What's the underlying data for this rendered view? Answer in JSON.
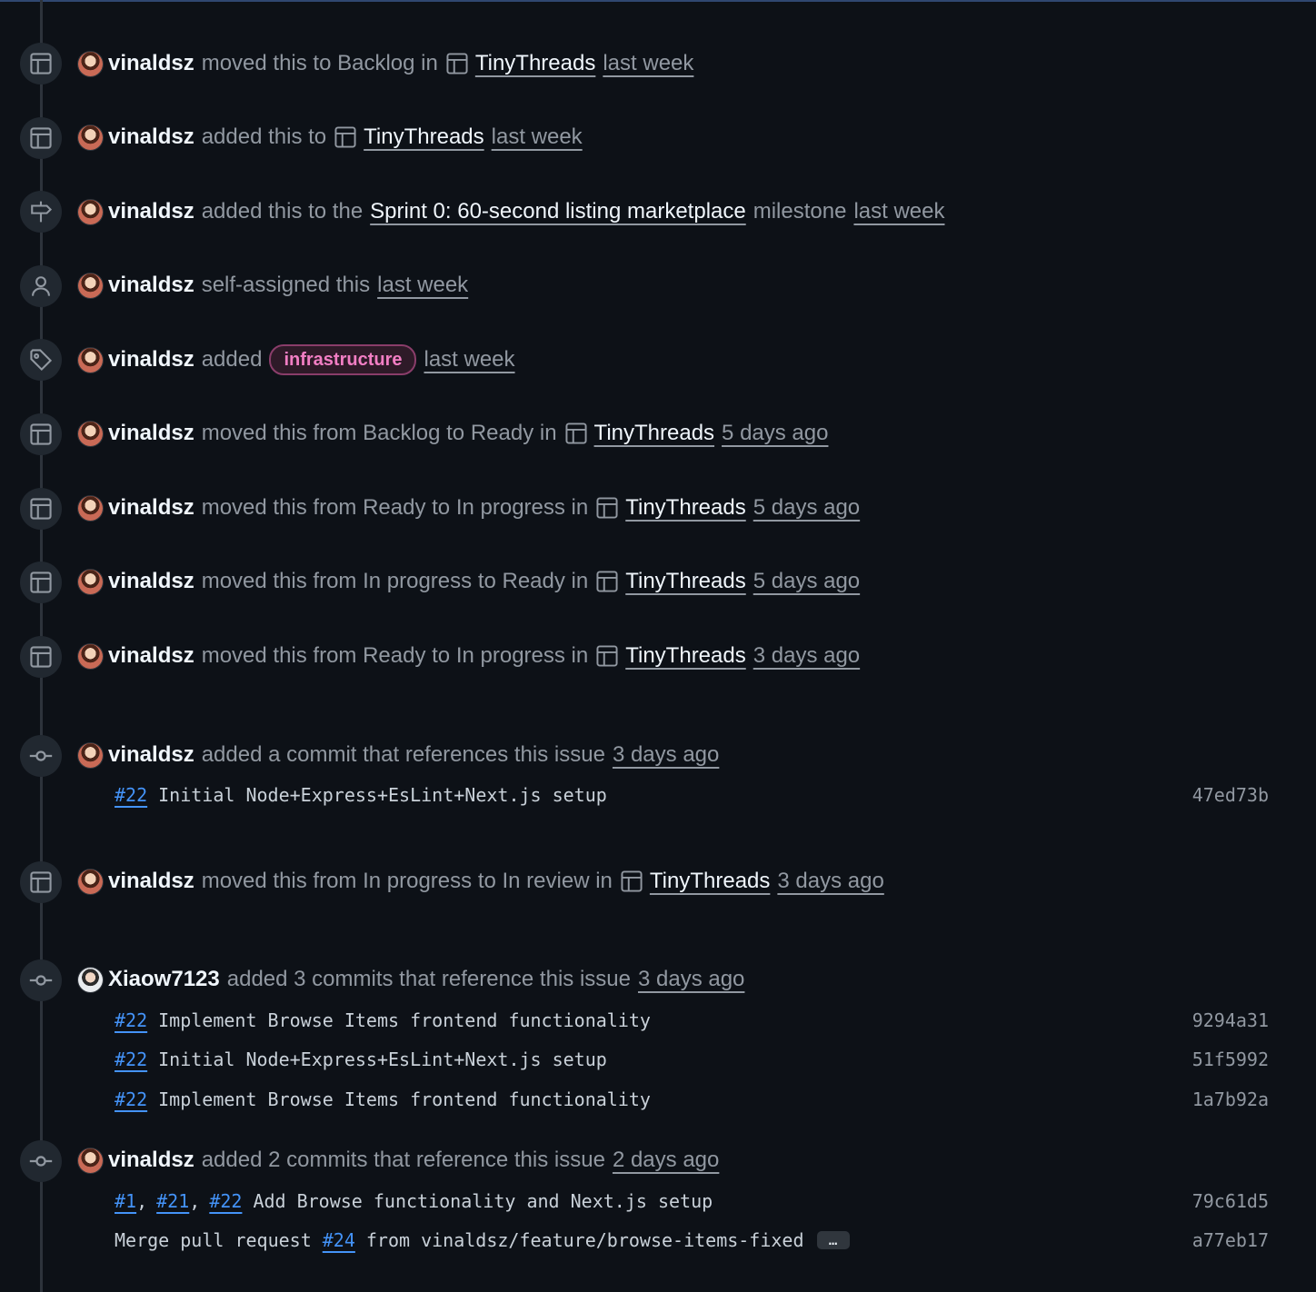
{
  "events": [
    {
      "icon": "project-icon",
      "user": "vinaldsz",
      "text": "moved this to Backlog in",
      "project": "TinyThreads",
      "time": "last week"
    },
    {
      "icon": "project-icon",
      "user": "vinaldsz",
      "text": "added this to",
      "project": "TinyThreads",
      "time": "last week"
    },
    {
      "icon": "milestone-icon",
      "user": "vinaldsz",
      "text": "added this to the",
      "milestone": "Sprint 0: 60-second listing marketplace",
      "text_after": "milestone",
      "time": "last week"
    },
    {
      "icon": "person-icon",
      "user": "vinaldsz",
      "text": "self-assigned this",
      "time": "last week"
    },
    {
      "icon": "tag-icon",
      "user": "vinaldsz",
      "text": "added",
      "label": "infrastructure",
      "time": "last week"
    },
    {
      "icon": "project-icon",
      "user": "vinaldsz",
      "text": "moved this from Backlog to Ready in",
      "project": "TinyThreads",
      "time": "5 days ago"
    },
    {
      "icon": "project-icon",
      "user": "vinaldsz",
      "text": "moved this from Ready to In progress in",
      "project": "TinyThreads",
      "time": "5 days ago"
    },
    {
      "icon": "project-icon",
      "user": "vinaldsz",
      "text": "moved this from In progress to Ready in",
      "project": "TinyThreads",
      "time": "5 days ago"
    },
    {
      "icon": "project-icon",
      "user": "vinaldsz",
      "text": "moved this from Ready to In progress in",
      "project": "TinyThreads",
      "time": "3 days ago"
    },
    {
      "icon": "commit-icon",
      "user": "vinaldsz",
      "text": "added a commit that references this issue",
      "time": "3 days ago",
      "commits": [
        {
          "refs": [
            "#22"
          ],
          "message": "Initial Node+Express+EsLint+Next.js setup",
          "sha": "47ed73b"
        }
      ]
    },
    {
      "icon": "project-icon",
      "user": "vinaldsz",
      "text": "moved this from In progress to In review in",
      "project": "TinyThreads",
      "time": "3 days ago"
    },
    {
      "icon": "commit-icon",
      "user": "Xiaow7123",
      "text": "added 3 commits that reference this issue",
      "time": "3 days ago",
      "commits": [
        {
          "refs": [
            "#22"
          ],
          "message": "Implement Browse Items frontend functionality",
          "sha": "9294a31"
        },
        {
          "refs": [
            "#22"
          ],
          "message": "Initial Node+Express+EsLint+Next.js setup",
          "sha": "51f5992"
        },
        {
          "refs": [
            "#22"
          ],
          "message": "Implement Browse Items frontend functionality",
          "sha": "1a7b92a"
        }
      ]
    },
    {
      "icon": "commit-icon",
      "user": "vinaldsz",
      "text": "added 2 commits that reference this issue",
      "time": "2 days ago",
      "commits": [
        {
          "refs": [
            "#1",
            "#21",
            "#22"
          ],
          "message": "Add Browse functionality and Next.js setup",
          "sha": "79c61d5"
        },
        {
          "prefix": "Merge pull request",
          "refs": [
            "#24"
          ],
          "message": "from vinaldsz/feature/browse-items-fixed",
          "ellipsis": "…",
          "sha": "a77eb17"
        }
      ]
    }
  ]
}
